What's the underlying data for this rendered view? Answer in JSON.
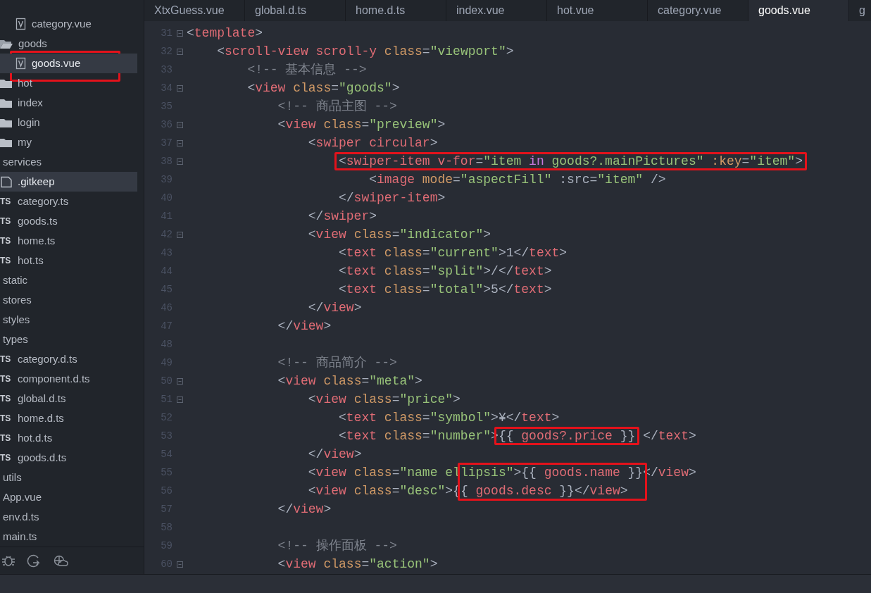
{
  "sidebar": {
    "items": [
      {
        "kind": "vue",
        "label": "category.vue",
        "selected": false,
        "boxed": false
      },
      {
        "kind": "folder-open",
        "label": "goods",
        "selected": false,
        "boxed": false,
        "children": [
          {
            "kind": "vue",
            "label": "goods.vue",
            "selected": true,
            "boxed": true
          }
        ]
      },
      {
        "kind": "folder",
        "label": "hot",
        "selected": false,
        "boxed": false
      },
      {
        "kind": "folder",
        "label": "index",
        "selected": false,
        "boxed": false
      },
      {
        "kind": "folder",
        "label": "login",
        "selected": false,
        "boxed": false
      },
      {
        "kind": "folder",
        "label": "my",
        "selected": false,
        "boxed": false
      },
      {
        "kind": "plain",
        "label": "services",
        "selected": false,
        "boxed": false
      },
      {
        "kind": "file",
        "label": ".gitkeep",
        "selected": true,
        "boxed": false
      },
      {
        "kind": "ts",
        "badge": "TS",
        "label": "category.ts",
        "selected": false,
        "boxed": false
      },
      {
        "kind": "ts",
        "badge": "TS",
        "label": "goods.ts",
        "selected": false,
        "boxed": false
      },
      {
        "kind": "ts",
        "badge": "TS",
        "label": "home.ts",
        "selected": false,
        "boxed": false
      },
      {
        "kind": "ts",
        "badge": "TS",
        "label": "hot.ts",
        "selected": false,
        "boxed": false
      },
      {
        "kind": "plain",
        "label": "static",
        "selected": false,
        "boxed": false
      },
      {
        "kind": "plain",
        "label": "stores",
        "selected": false,
        "boxed": false
      },
      {
        "kind": "plain",
        "label": "styles",
        "selected": false,
        "boxed": false
      },
      {
        "kind": "plain",
        "label": "types",
        "selected": false,
        "boxed": false
      },
      {
        "kind": "ts",
        "badge": "TS",
        "label": "category.d.ts",
        "selected": false,
        "boxed": false
      },
      {
        "kind": "ts",
        "badge": "TS",
        "label": "component.d.ts",
        "selected": false,
        "boxed": false
      },
      {
        "kind": "ts",
        "badge": "TS",
        "label": "global.d.ts",
        "selected": false,
        "boxed": false
      },
      {
        "kind": "ts",
        "badge": "TS",
        "label": "home.d.ts",
        "selected": false,
        "boxed": false
      },
      {
        "kind": "ts",
        "badge": "TS",
        "label": "hot.d.ts",
        "selected": false,
        "boxed": false
      },
      {
        "kind": "ts",
        "badge": "TS",
        "label": "goods.d.ts",
        "selected": false,
        "boxed": false
      },
      {
        "kind": "plain",
        "label": "utils",
        "selected": false,
        "boxed": false
      },
      {
        "kind": "plain",
        "label": "App.vue",
        "selected": false,
        "boxed": false
      },
      {
        "kind": "plain",
        "label": "env.d.ts",
        "selected": false,
        "boxed": false
      },
      {
        "kind": "plain",
        "label": "main.ts",
        "selected": false,
        "boxed": false
      }
    ],
    "toolbar": [
      {
        "kind": "bug"
      },
      {
        "kind": "sync"
      },
      {
        "kind": "cloud"
      }
    ]
  },
  "tabs": [
    {
      "label": "XtxGuess.vue",
      "selected": false
    },
    {
      "label": "global.d.ts",
      "selected": false
    },
    {
      "label": "home.d.ts",
      "selected": false
    },
    {
      "label": "index.vue",
      "selected": false
    },
    {
      "label": "hot.vue",
      "selected": false
    },
    {
      "label": "category.vue",
      "selected": false
    },
    {
      "label": "goods.vue",
      "selected": true
    },
    {
      "label": "g",
      "selected": false
    }
  ],
  "editor": {
    "lines": [
      {
        "number": "31",
        "fold": true,
        "tokens": [
          {
            "kind": "punct",
            "text": "<"
          },
          {
            "kind": "tag",
            "text": "template"
          },
          {
            "kind": "punct",
            "text": ">"
          }
        ]
      },
      {
        "number": "32",
        "fold": true,
        "tokens": [
          {
            "kind": "punct",
            "text": "    <"
          },
          {
            "kind": "tag",
            "text": "scroll-view scroll-y "
          },
          {
            "kind": "attr",
            "text": "class"
          },
          {
            "kind": "punct",
            "text": "="
          },
          {
            "kind": "string",
            "text": "\"viewport\""
          },
          {
            "kind": "punct",
            "text": ">"
          }
        ]
      },
      {
        "number": "33",
        "fold": false,
        "tokens": [
          {
            "kind": "comment",
            "text": "        <!-- 基本信息 -->"
          }
        ]
      },
      {
        "number": "34",
        "fold": true,
        "tokens": [
          {
            "kind": "punct",
            "text": "        <"
          },
          {
            "kind": "tag",
            "text": "view "
          },
          {
            "kind": "attr",
            "text": "class"
          },
          {
            "kind": "punct",
            "text": "="
          },
          {
            "kind": "string",
            "text": "\"goods\""
          },
          {
            "kind": "punct",
            "text": ">"
          }
        ]
      },
      {
        "number": "35",
        "fold": false,
        "tokens": [
          {
            "kind": "comment",
            "text": "            <!-- 商品主图 -->"
          }
        ]
      },
      {
        "number": "36",
        "fold": true,
        "tokens": [
          {
            "kind": "punct",
            "text": "            <"
          },
          {
            "kind": "tag",
            "text": "view "
          },
          {
            "kind": "attr",
            "text": "class"
          },
          {
            "kind": "punct",
            "text": "="
          },
          {
            "kind": "string",
            "text": "\"preview\""
          },
          {
            "kind": "punct",
            "text": ">"
          }
        ]
      },
      {
        "number": "37",
        "fold": true,
        "tokens": [
          {
            "kind": "punct",
            "text": "                <"
          },
          {
            "kind": "tag",
            "text": "swiper circular"
          },
          {
            "kind": "punct",
            "text": ">"
          }
        ]
      },
      {
        "number": "38",
        "fold": true,
        "tokens": [
          {
            "kind": "boxed",
            "tokens": [
              {
                "kind": "punct",
                "text": "                    <"
              },
              {
                "kind": "tag",
                "text": "swiper-item v-for"
              },
              {
                "kind": "punct",
                "text": "="
              },
              {
                "kind": "string",
                "text": "\"item "
              },
              {
                "kind": "keyword",
                "text": "in"
              },
              {
                "kind": "string",
                "text": " goods?.mainPictures\" "
              },
              {
                "kind": "attr",
                "text": ":key"
              },
              {
                "kind": "punct",
                "text": "="
              },
              {
                "kind": "string",
                "text": "\"item\""
              },
              {
                "kind": "punct",
                "text": ">"
              }
            ]
          }
        ]
      },
      {
        "number": "39",
        "fold": false,
        "tokens": [
          {
            "kind": "punct",
            "text": "                        <"
          },
          {
            "kind": "tag",
            "text": "image "
          },
          {
            "kind": "attr",
            "text": "mode"
          },
          {
            "kind": "punct",
            "text": "="
          },
          {
            "kind": "string",
            "text": "\"aspectFill\""
          },
          {
            "kind": "punct",
            "text": " :src="
          },
          {
            "kind": "string",
            "text": "\"item\""
          },
          {
            "kind": "punct",
            "text": " />"
          }
        ]
      },
      {
        "number": "40",
        "fold": false,
        "tokens": [
          {
            "kind": "punct",
            "text": "                    </"
          },
          {
            "kind": "tag",
            "text": "swiper-item"
          },
          {
            "kind": "punct",
            "text": ">"
          }
        ]
      },
      {
        "number": "41",
        "fold": false,
        "tokens": [
          {
            "kind": "punct",
            "text": "                </"
          },
          {
            "kind": "tag",
            "text": "swiper"
          },
          {
            "kind": "punct",
            "text": ">"
          }
        ]
      },
      {
        "number": "42",
        "fold": true,
        "tokens": [
          {
            "kind": "punct",
            "text": "                <"
          },
          {
            "kind": "tag",
            "text": "view "
          },
          {
            "kind": "attr",
            "text": "class"
          },
          {
            "kind": "punct",
            "text": "="
          },
          {
            "kind": "string",
            "text": "\"indicator\""
          },
          {
            "kind": "punct",
            "text": ">"
          }
        ]
      },
      {
        "number": "43",
        "fold": false,
        "tokens": [
          {
            "kind": "punct",
            "text": "                    <"
          },
          {
            "kind": "tag",
            "text": "text "
          },
          {
            "kind": "attr",
            "text": "class"
          },
          {
            "kind": "punct",
            "text": "="
          },
          {
            "kind": "string",
            "text": "\"current\""
          },
          {
            "kind": "punct",
            "text": ">1</"
          },
          {
            "kind": "tag",
            "text": "text"
          },
          {
            "kind": "punct",
            "text": ">"
          }
        ]
      },
      {
        "number": "44",
        "fold": false,
        "tokens": [
          {
            "kind": "punct",
            "text": "                    <"
          },
          {
            "kind": "tag",
            "text": "text "
          },
          {
            "kind": "attr",
            "text": "class"
          },
          {
            "kind": "punct",
            "text": "="
          },
          {
            "kind": "string",
            "text": "\"split\""
          },
          {
            "kind": "punct",
            "text": ">/</"
          },
          {
            "kind": "tag",
            "text": "text"
          },
          {
            "kind": "punct",
            "text": ">"
          }
        ]
      },
      {
        "number": "45",
        "fold": false,
        "tokens": [
          {
            "kind": "punct",
            "text": "                    <"
          },
          {
            "kind": "tag",
            "text": "text "
          },
          {
            "kind": "attr",
            "text": "class"
          },
          {
            "kind": "punct",
            "text": "="
          },
          {
            "kind": "string",
            "text": "\"total\""
          },
          {
            "kind": "punct",
            "text": ">5</"
          },
          {
            "kind": "tag",
            "text": "text"
          },
          {
            "kind": "punct",
            "text": ">"
          }
        ]
      },
      {
        "number": "46",
        "fold": false,
        "tokens": [
          {
            "kind": "punct",
            "text": "                </"
          },
          {
            "kind": "tag",
            "text": "view"
          },
          {
            "kind": "punct",
            "text": ">"
          }
        ]
      },
      {
        "number": "47",
        "fold": false,
        "tokens": [
          {
            "kind": "punct",
            "text": "            </"
          },
          {
            "kind": "tag",
            "text": "view"
          },
          {
            "kind": "punct",
            "text": ">"
          }
        ]
      },
      {
        "number": "48",
        "fold": false
      },
      {
        "number": "49",
        "fold": false,
        "tokens": [
          {
            "kind": "comment",
            "text": "            <!-- 商品简介 -->"
          }
        ]
      },
      {
        "number": "50",
        "fold": true,
        "tokens": [
          {
            "kind": "punct",
            "text": "            <"
          },
          {
            "kind": "tag",
            "text": "view "
          },
          {
            "kind": "attr",
            "text": "class"
          },
          {
            "kind": "punct",
            "text": "="
          },
          {
            "kind": "string",
            "text": "\"meta\""
          },
          {
            "kind": "punct",
            "text": ">"
          }
        ]
      },
      {
        "number": "51",
        "fold": true,
        "tokens": [
          {
            "kind": "punct",
            "text": "                <"
          },
          {
            "kind": "tag",
            "text": "view "
          },
          {
            "kind": "attr",
            "text": "class"
          },
          {
            "kind": "punct",
            "text": "="
          },
          {
            "kind": "string",
            "text": "\"price\""
          },
          {
            "kind": "punct",
            "text": ">"
          }
        ]
      },
      {
        "number": "52",
        "fold": false,
        "tokens": [
          {
            "kind": "punct",
            "text": "                    <"
          },
          {
            "kind": "tag",
            "text": "text "
          },
          {
            "kind": "attr",
            "text": "class"
          },
          {
            "kind": "punct",
            "text": "="
          },
          {
            "kind": "string",
            "text": "\"symbol\""
          },
          {
            "kind": "punct",
            "text": ">¥</"
          },
          {
            "kind": "tag",
            "text": "text"
          },
          {
            "kind": "punct",
            "text": ">"
          }
        ]
      },
      {
        "number": "53",
        "fold": false,
        "tokens": [
          {
            "kind": "punct",
            "text": "                    <"
          },
          {
            "kind": "tag",
            "text": "text "
          },
          {
            "kind": "attr",
            "text": "class"
          },
          {
            "kind": "punct",
            "text": "="
          },
          {
            "kind": "string",
            "text": "\"number\""
          },
          {
            "kind": "punct",
            "text": ">"
          },
          {
            "kind": "boxed",
            "tokens": [
              {
                "kind": "punct",
                "text": "{{ "
              },
              {
                "kind": "expr",
                "text": "goods?.price"
              },
              {
                "kind": "punct",
                "text": " }}"
              }
            ]
          },
          {
            "kind": "punct",
            "text": " </"
          },
          {
            "kind": "tag",
            "text": "text"
          },
          {
            "kind": "punct",
            "text": ">"
          }
        ]
      },
      {
        "number": "54",
        "fold": false,
        "tokens": [
          {
            "kind": "punct",
            "text": "                </"
          },
          {
            "kind": "tag",
            "text": "view"
          },
          {
            "kind": "punct",
            "text": ">"
          }
        ]
      },
      {
        "number": "55",
        "fold": false,
        "tokens": [
          {
            "kind": "punct",
            "text": "                <"
          },
          {
            "kind": "tag",
            "text": "view "
          },
          {
            "kind": "attr",
            "text": "class"
          },
          {
            "kind": "punct",
            "text": "="
          },
          {
            "kind": "string",
            "text": "\"name el"
          },
          {
            "kind": "boxed",
            "tokens": [
              {
                "kind": "string",
                "text": "lipsis\""
              },
              {
                "kind": "punct",
                "text": ">{{ "
              },
              {
                "kind": "expr",
                "text": "goods.name"
              },
              {
                "kind": "punct",
                "text": " }}"
              }
            ]
          },
          {
            "kind": "punct",
            "text": "</"
          },
          {
            "kind": "tag",
            "text": "view"
          },
          {
            "kind": "punct",
            "text": ">"
          }
        ]
      },
      {
        "number": "56",
        "fold": false,
        "tokens": [
          {
            "kind": "punct",
            "text": "                <"
          },
          {
            "kind": "tag",
            "text": "view "
          },
          {
            "kind": "attr",
            "text": "class"
          },
          {
            "kind": "punct",
            "text": "="
          },
          {
            "kind": "string",
            "text": "\"desc\""
          },
          {
            "kind": "punct",
            "text": ">{"
          },
          {
            "kind": "boxed",
            "tokens": [
              {
                "kind": "punct",
                "text": "{ "
              },
              {
                "kind": "expr",
                "text": "goods.desc"
              },
              {
                "kind": "punct",
                "text": " }}"
              }
            ]
          },
          {
            "kind": "punct",
            "text": "</"
          },
          {
            "kind": "tag",
            "text": "view"
          },
          {
            "kind": "punct",
            "text": ">"
          }
        ]
      },
      {
        "number": "57",
        "fold": false,
        "tokens": [
          {
            "kind": "punct",
            "text": "            </"
          },
          {
            "kind": "tag",
            "text": "view"
          },
          {
            "kind": "punct",
            "text": ">"
          }
        ]
      },
      {
        "number": "58",
        "fold": false
      },
      {
        "number": "59",
        "fold": false,
        "tokens": [
          {
            "kind": "comment",
            "text": "            <!-- 操作面板 -->"
          }
        ]
      },
      {
        "number": "60",
        "fold": true,
        "tokens": [
          {
            "kind": "punct",
            "text": "            <"
          },
          {
            "kind": "tag",
            "text": "view "
          },
          {
            "kind": "attr",
            "text": "class"
          },
          {
            "kind": "punct",
            "text": "="
          },
          {
            "kind": "string",
            "text": "\"action\""
          },
          {
            "kind": "punct",
            "text": ">"
          }
        ]
      }
    ]
  }
}
